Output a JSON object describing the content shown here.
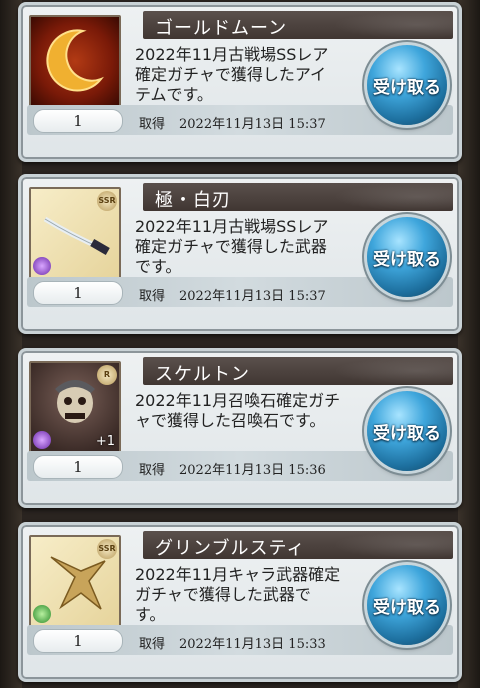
{
  "items": [
    {
      "title": "ゴールドムーン",
      "desc_lines": [
        "2022年11月古戦場SSレア",
        "確定ガチャで獲得したアイ",
        "テムです。"
      ],
      "quantity": "1",
      "acquired_label": "取得",
      "acquired_date": "2022年11月13日 15:37",
      "button_label": "受け取る",
      "thumb_icon": "gold-moon-icon",
      "rarity_badge": ""
    },
    {
      "title": "極・白刃",
      "desc_lines": [
        "2022年11月古戦場SSレア",
        "確定ガチャで獲得した武器",
        "です。"
      ],
      "quantity": "1",
      "acquired_label": "取得",
      "acquired_date": "2022年11月13日 15:37",
      "button_label": "受け取る",
      "thumb_icon": "katana-weapon-icon",
      "rarity_badge": "SSR"
    },
    {
      "title": "スケルトン",
      "desc_lines": [
        "2022年11月召喚石確定ガチ",
        "ャで獲得した召喚石です。",
        ""
      ],
      "quantity": "1",
      "acquired_label": "取得",
      "acquired_date": "2022年11月13日 15:36",
      "button_label": "受け取る",
      "thumb_icon": "skeleton-summon-icon",
      "rarity_badge": "R",
      "plus": "+1"
    },
    {
      "title": "グリンブルスティ",
      "desc_lines": [
        "2022年11月キャラ武器確定",
        "ガチャで獲得した武器で",
        "す。"
      ],
      "quantity": "1",
      "acquired_label": "取得",
      "acquired_date": "2022年11月13日 15:33",
      "button_label": "受け取る",
      "thumb_icon": "boar-weapon-icon",
      "rarity_badge": "SSR"
    }
  ]
}
